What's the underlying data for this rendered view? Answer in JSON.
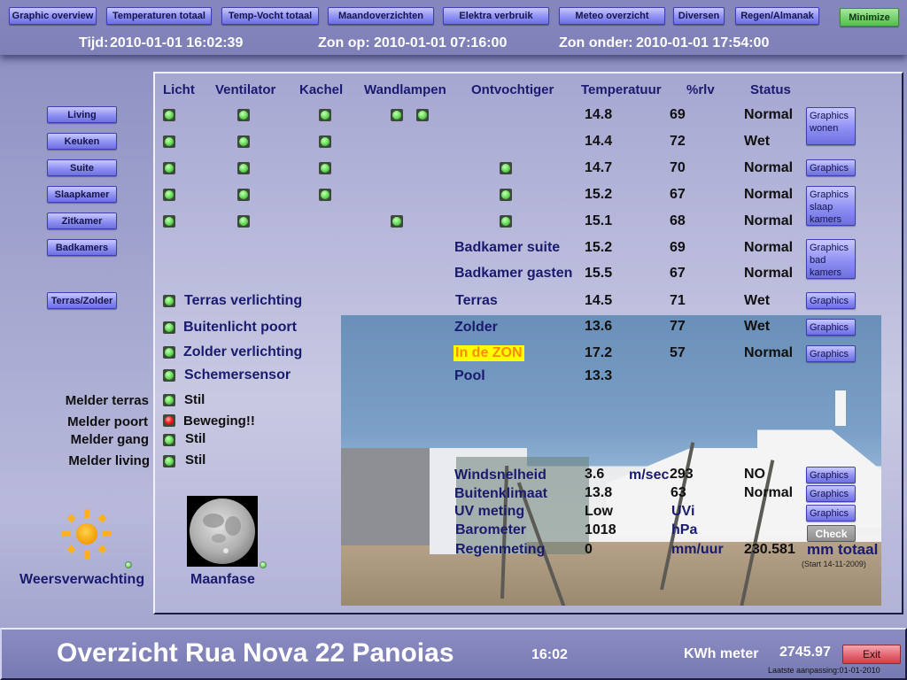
{
  "nav": {
    "buttons": [
      "Graphic overview",
      "Temperaturen totaal",
      "Temp-Vocht totaal",
      "Maandoverzichten",
      "Elektra verbruik",
      "Meteo overzicht",
      "Diversen",
      "Regen/Almanak"
    ],
    "minimize": "Minimize"
  },
  "header": {
    "time_label": "Tijd:",
    "time_value": "2010-01-01 16:02:39",
    "sunrise_label": "Zon op:",
    "sunrise_value": "2010-01-01 07:16:00",
    "sunset_label": "Zon onder:",
    "sunset_value": "2010-01-01 17:54:00"
  },
  "columns": [
    "Licht",
    "Ventilator",
    "Kachel",
    "Wandlampen",
    "Ontvochtiger",
    "Temperatuur",
    "%rlv",
    "Status"
  ],
  "rooms": [
    {
      "button": "Living",
      "licht": true,
      "ventilator": true,
      "kachel": true,
      "wandlampen": 2,
      "ontvochtiger": false,
      "temp": "14.8",
      "rlv": "69",
      "status": "Normal"
    },
    {
      "button": "Keuken",
      "licht": true,
      "ventilator": true,
      "kachel": true,
      "wandlampen": 0,
      "ontvochtiger": false,
      "temp": "14.4",
      "rlv": "72",
      "status": "Wet"
    },
    {
      "button": "Suite",
      "licht": true,
      "ventilator": true,
      "kachel": true,
      "wandlampen": 0,
      "ontvochtiger": true,
      "temp": "14.7",
      "rlv": "70",
      "status": "Normal"
    },
    {
      "button": "Slaapkamer",
      "licht": true,
      "ventilator": true,
      "kachel": true,
      "wandlampen": 0,
      "ontvochtiger": true,
      "temp": "15.2",
      "rlv": "67",
      "status": "Normal"
    },
    {
      "button": "Zitkamer",
      "licht": true,
      "ventilator": true,
      "kachel": false,
      "wandlampen": 1,
      "ontvochtiger": true,
      "temp": "15.1",
      "rlv": "68",
      "status": "Normal"
    }
  ],
  "badkamers": {
    "button": "Badkamers",
    "rows": [
      {
        "name": "Badkamer suite",
        "temp": "15.2",
        "rlv": "69",
        "status": "Normal"
      },
      {
        "name": "Badkamer gasten",
        "temp": "15.5",
        "rlv": "67",
        "status": "Normal"
      }
    ]
  },
  "terras_button": "Terras/Zolder",
  "outdoor_lights": [
    {
      "name": "Terras verlichting",
      "on": true
    },
    {
      "name": "Buitenlicht poort",
      "on": true
    },
    {
      "name": "Zolder verlichting",
      "on": true
    },
    {
      "name": "Schemersensor",
      "on": true
    }
  ],
  "outdoor_sensors": [
    {
      "name": "Terras",
      "temp": "14.5",
      "rlv": "71",
      "status": "Wet"
    },
    {
      "name": "Zolder",
      "temp": "13.6",
      "rlv": "77",
      "status": "Wet"
    },
    {
      "name": "In de ZON",
      "temp": "17.2",
      "rlv": "57",
      "status": "Normal",
      "highlight": "#ffff00"
    },
    {
      "name": "Pool",
      "temp": "13.3"
    }
  ],
  "motion": [
    {
      "name": "Melder terras",
      "state": "Stil",
      "alarm": false
    },
    {
      "name": "Melder poort",
      "state": "Beweging!!",
      "alarm": true
    },
    {
      "name": "Melder gang",
      "state": "Stil",
      "alarm": false
    },
    {
      "name": "Melder living",
      "state": "Stil",
      "alarm": false
    }
  ],
  "graphics_buttons": {
    "wonen": "Graphics wonen",
    "suite": "Graphics",
    "slaap": "Graphics slaap kamers",
    "bad": "Graphics bad kamers",
    "terras": "Graphics",
    "zolder": "Graphics",
    "zon": "Graphics",
    "wind": "Graphics",
    "klimaat": "Graphics",
    "uv": "Graphics",
    "check": "Check"
  },
  "weather": {
    "wind": {
      "label": "Windsnelheid",
      "value": "3.6",
      "unit": "m/sec",
      "dir_deg": "293",
      "dir": "NO"
    },
    "klimaat": {
      "label": "Buitenklimaat",
      "value": "13.8",
      "rlv": "63",
      "status": "Normal"
    },
    "uv": {
      "label": "UV meting",
      "value": "Low",
      "unit": "UVi"
    },
    "baro": {
      "label": "Barometer",
      "value": "1018",
      "unit": "hPa"
    },
    "regen": {
      "label": "Regenmeting",
      "value": "0",
      "unit": "mm/uur",
      "total": "230.581",
      "total_unit": "mm totaal",
      "start": "(Start 14-11-2009)"
    }
  },
  "widgets": {
    "forecast": "Weersverwachting",
    "moon": "Maanfase"
  },
  "footer": {
    "title": "Overzicht Rua Nova 22 Panoias",
    "clock": "16:02",
    "kwh_label": "KWh meter",
    "kwh_value": "2745.97",
    "exit": "Exit",
    "last_update": "Laatste aanpassing:01-01-2010"
  }
}
